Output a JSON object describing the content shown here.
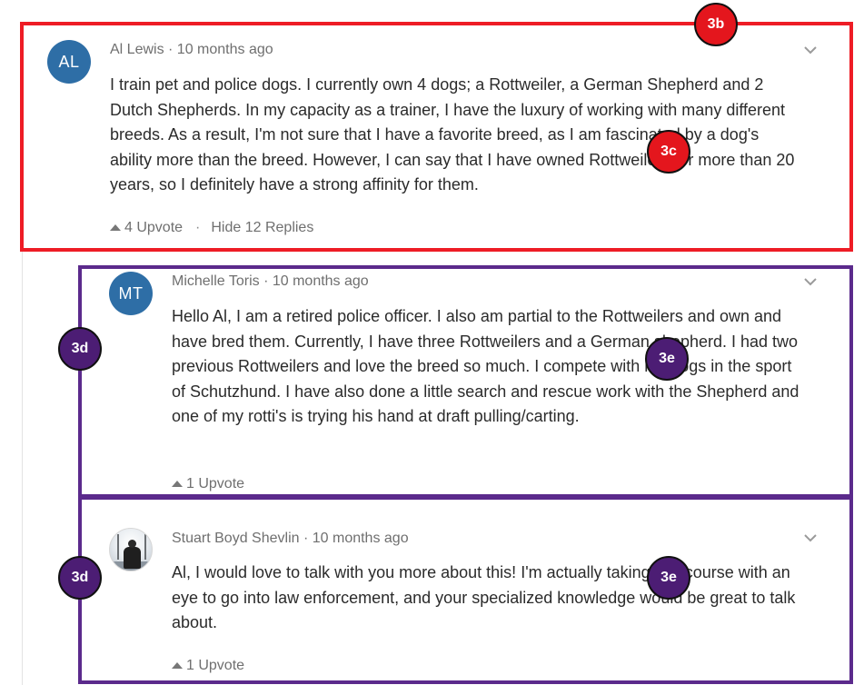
{
  "comments": [
    {
      "avatar_initials": "AL",
      "meta": "Al Lewis · 10 months ago",
      "body": "I train pet and police dogs. I currently own 4 dogs; a Rottweiler, a German Shepherd and 2 Dutch Shepherds. In my capacity as a trainer, I have the luxury of working with many different breeds. As a result, I'm not sure that I have a favorite breed, as I am fascinated by a dog's ability more than the breed. However, I can say that I have owned Rottweilers for more than 20 years, so I definitely have a strong affinity for them.",
      "upvote_label": "4 Upvote",
      "separator": "·",
      "replies_label": "Hide 12 Replies"
    },
    {
      "avatar_initials": "MT",
      "meta": "Michelle Toris · 10 months ago",
      "body": "Hello Al, I am a retired police officer. I also am partial to the Rottweilers and own and have bred them. Currently, I have three Rottweilers and a German shepherd. I had two previous Rottweilers and love the breed so much. I compete with my dogs in the sport of Schutzhund. I have also done a little search and rescue work with the Shepherd and one of my rotti's is trying his hand at draft pulling/carting.",
      "upvote_label": "1 Upvote"
    },
    {
      "meta": "Stuart Boyd Shevlin · 10 months ago",
      "body": "Al, I would love to talk with you more about this! I'm actually taking this course with an eye to go into law enforcement, and your specialized knowledge would be great to talk about.",
      "upvote_label": "1 Upvote"
    }
  ],
  "annotations": {
    "b3b": "3b",
    "b3c": "3c",
    "b3d_1": "3d",
    "b3e_1": "3e",
    "b3d_2": "3d",
    "b3e_2": "3e"
  },
  "colors": {
    "avatar": "#2e6ea6",
    "red_annotation": "#ee1c25",
    "purple_annotation": "#5b2a8c"
  },
  "icons": [
    "chevron-down-icon",
    "upvote-arrow-icon"
  ]
}
